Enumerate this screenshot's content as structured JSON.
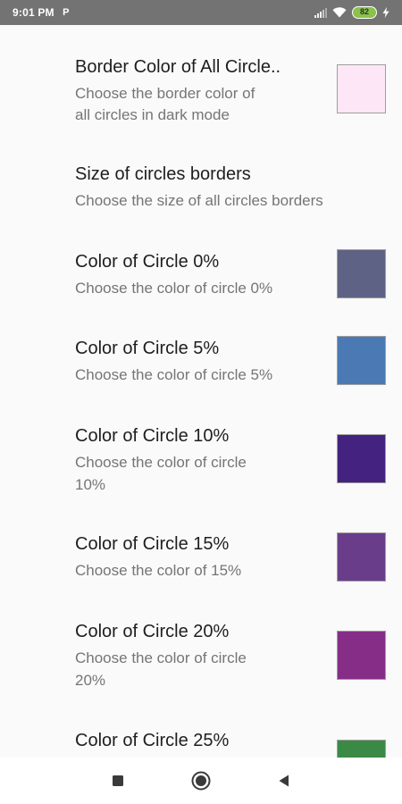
{
  "status_bar": {
    "time": "9:01 PM",
    "notification_icon": "P",
    "battery_level": "82",
    "icons": [
      "signal-icon",
      "wifi-icon",
      "battery-icon",
      "charging-icon"
    ]
  },
  "preferences": [
    {
      "title": "Border Color of All Circle..",
      "summary_lines": [
        " Choose the border color of",
        "all circles in dark mode"
      ],
      "swatch_color": "#fde6f5"
    },
    {
      "title": "Size of circles borders",
      "summary_lines": [
        "Choose the size of all circles borders"
      ],
      "swatch_color": null
    },
    {
      "title": "Color of Circle 0%",
      "summary_lines": [
        "Choose the color of circle 0%"
      ],
      "swatch_color": "#5e6385"
    },
    {
      "title": "Color of Circle 5%",
      "summary_lines": [
        "Choose the color of circle 5%"
      ],
      "swatch_color": "#4a79b4"
    },
    {
      "title": "Color of Circle 10%",
      "summary_lines": [
        "Choose the color of circle",
        "10%"
      ],
      "swatch_color": "#43237f"
    },
    {
      "title": "Color of Circle 15%",
      "summary_lines": [
        "Choose the color of 15%"
      ],
      "swatch_color": "#6a3d8a"
    },
    {
      "title": "Color of Circle 20%",
      "summary_lines": [
        "Choose the color of circle",
        "20%"
      ],
      "swatch_color": "#862d87"
    },
    {
      "title": "Color of Circle 25%",
      "summary_lines": [],
      "swatch_color": "#3a8a46"
    }
  ],
  "nav_bar": {
    "buttons": [
      "recents-button",
      "home-button",
      "back-button"
    ]
  }
}
